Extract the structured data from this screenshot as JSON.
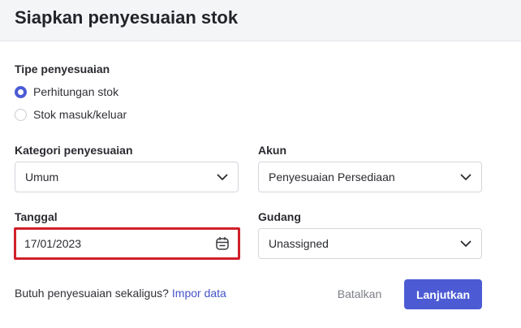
{
  "header": {
    "title": "Siapkan penyesuaian stok"
  },
  "adjustment_type": {
    "label": "Tipe penyesuaian",
    "options": [
      {
        "label": "Perhitungan stok",
        "checked": true
      },
      {
        "label": "Stok masuk/keluar",
        "checked": false
      }
    ]
  },
  "category": {
    "label": "Kategori penyesuaian",
    "value": "Umum"
  },
  "account": {
    "label": "Akun",
    "value": "Penyesuaian Persediaan"
  },
  "date": {
    "label": "Tanggal",
    "value": "17/01/2023"
  },
  "warehouse": {
    "label": "Gudang",
    "value": "Unassigned"
  },
  "footer": {
    "prompt": "Butuh penyesuaian sekaligus?",
    "import_link": "Impor data",
    "cancel_label": "Batalkan",
    "continue_label": "Lanjutkan"
  },
  "colors": {
    "accent": "#4c5bd4",
    "highlight": "#d0202a"
  }
}
